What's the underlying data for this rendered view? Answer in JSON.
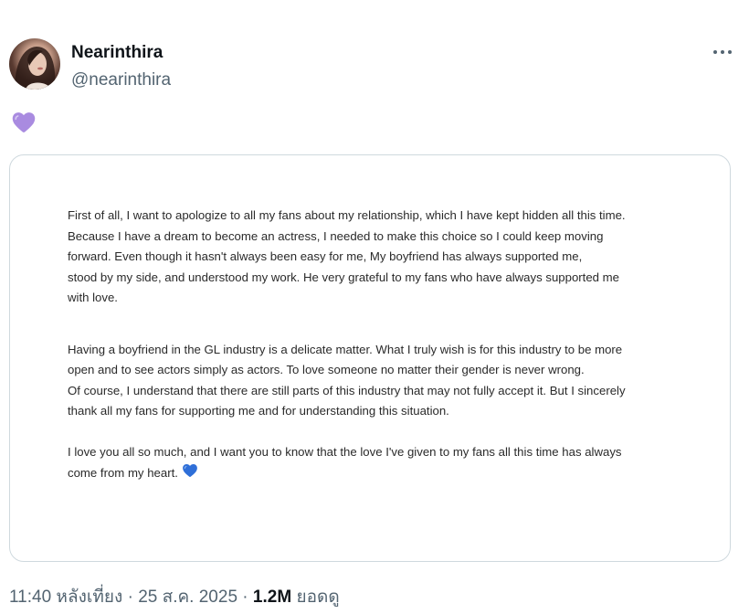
{
  "author": {
    "display_name": "Nearinthira",
    "handle": "@nearinthira"
  },
  "tweet": {
    "emoji_icon": "purple-heart",
    "image_text": {
      "paragraph_1": [
        "First of all, I want to apologize to all my fans about my relationship, which I have kept hidden all this time.",
        "Because I have a dream to become an actress, I needed to make this choice so I could keep moving",
        "forward. Even though it hasn't always been easy for me, My boyfriend has always supported me,",
        "stood by my side, and understood my work. He very grateful to my fans who have always supported me",
        "with love."
      ],
      "paragraph_2": [
        "Having a boyfriend in the GL industry is a delicate matter. What I truly wish is for this industry to be more",
        "open and to see actors simply as actors. To love someone no matter their gender is never wrong.",
        "Of course, I understand that there are still parts of this industry that may not fully accept it. But I sincerely",
        "thank all my fans for supporting me and for understanding this situation."
      ],
      "paragraph_3": [
        "I love you all so much, and I want you to know that the love I've given to my fans all this time has always",
        "come from my heart."
      ],
      "closing_emoji_icon": "blue-heart"
    }
  },
  "meta": {
    "time": "11:40 หลังเที่ยง",
    "separator": "·",
    "date": "25 ส.ค. 2025",
    "views_count": "1.2M",
    "views_label": "ยอดดู"
  },
  "colors": {
    "purple_heart": "#a98be0",
    "blue_heart": "#2f6fd8",
    "secondary_text": "#536471",
    "border": "#cfd9de"
  }
}
